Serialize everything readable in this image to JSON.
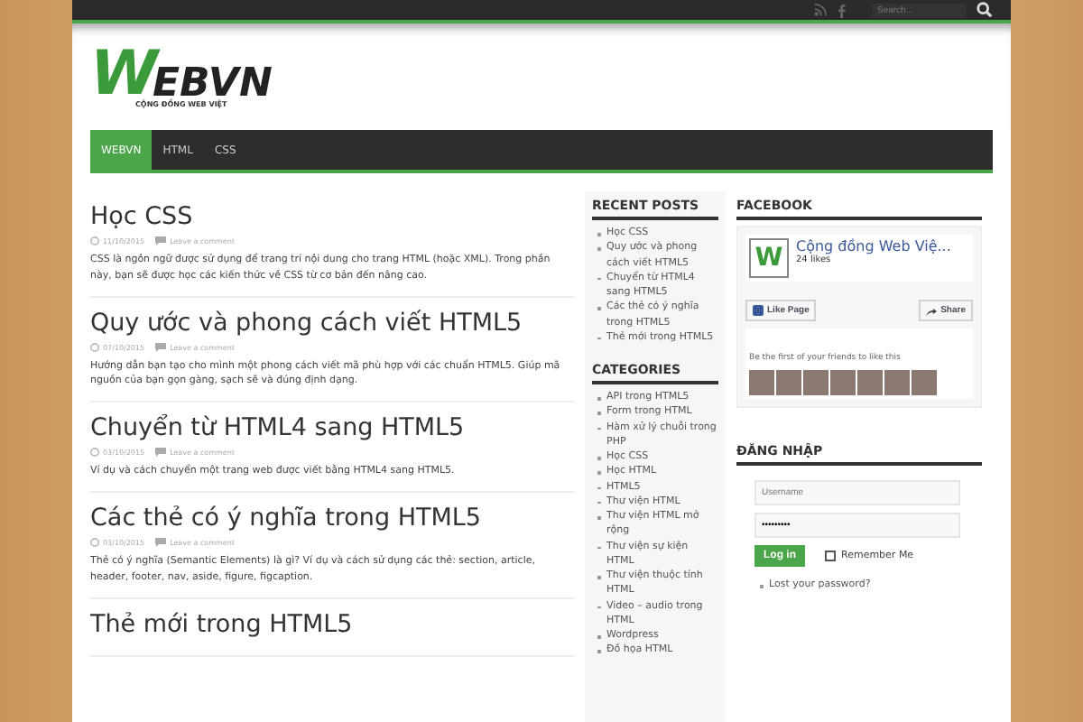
{
  "top_bar": {
    "search": {
      "placeholder": "Search..."
    }
  },
  "logo": {
    "name_first": "W",
    "name_rest": "EBVN",
    "tagline": "CỘNG ĐỒNG WEB VIỆT"
  },
  "nav": [
    {
      "label": "WEBVN",
      "selected": true
    },
    {
      "label": "HTML",
      "selected": false
    },
    {
      "label": "CSS",
      "selected": false
    }
  ],
  "posts": [
    {
      "title": "Học CSS",
      "date": "11/10/2015",
      "comments": "Leave a comment",
      "excerpt": "CSS là ngôn ngữ được sử dụng để trang trí nội dung cho trang HTML (hoặc XML). Trong phần này, bạn sẽ được học các kiến thức về CSS từ cơ bản đến nâng cao."
    },
    {
      "title": "Quy ước và phong cách viết HTML5",
      "date": "07/10/2015",
      "comments": "Leave a comment",
      "excerpt": "Hướng dẫn bạn tạo cho mình một phong cách viết mã phù hợp với các chuẩn HTML5. Giúp mã nguồn của bạn gọn gàng, sạch sẽ và đúng định dạng."
    },
    {
      "title": "Chuyển từ HTML4 sang HTML5",
      "date": "03/10/2015",
      "comments": "Leave a comment",
      "excerpt": "Ví dụ và cách chuyển một trang web được viết bằng HTML4 sang HTML5."
    },
    {
      "title": "Các thẻ có ý nghĩa trong HTML5",
      "date": "03/10/2015",
      "comments": "Leave a comment",
      "excerpt": "Thẻ có ý nghĩa (Semantic Elements) là gì? Ví dụ và cách sử dụng các thẻ: section, article, header, footer, nav, aside, figure, figcaption."
    },
    {
      "title": "Thẻ mới trong HTML5"
    }
  ],
  "recent_posts": {
    "title": "RECENT POSTS",
    "items": [
      "Học CSS",
      "Quy ước và phong cách viết HTML5",
      "Chuyển từ HTML4 sang HTML5",
      "Các thẻ có ý nghĩa trong HTML5",
      "Thẻ mới trong HTML5"
    ]
  },
  "categories": {
    "title": "CATEGORIES",
    "items": [
      "API trong HTML5",
      "Form trong HTML",
      "Hàm xử lý chuỗi trong PHP",
      "Học CSS",
      "Học HTML",
      "HTML5",
      "Thư viện HTML",
      "Thư viện HTML mở rộng",
      "Thư viện sự kiện HTML",
      "Thư viện thuộc tính HTML",
      "Video – audio trong HTML",
      "Wordpress",
      "Đồ họa HTML"
    ]
  },
  "facebook": {
    "title": "FACEBOOK",
    "logo_letter": "W",
    "page_name": "Cộng đồng Web Việ...",
    "likes": "24 likes",
    "like_button": "Like Page",
    "share_button": "Share",
    "friends_text": "Be the first of your friends to like this"
  },
  "login": {
    "title": "ĐĂNG NHẬP",
    "username": {
      "placeholder": "Username"
    },
    "password": {
      "value": "•••••••••"
    },
    "login_button": "Log in",
    "remember": {
      "label": "Remember Me",
      "checked": false
    },
    "lost_password": "Lost your password?"
  }
}
